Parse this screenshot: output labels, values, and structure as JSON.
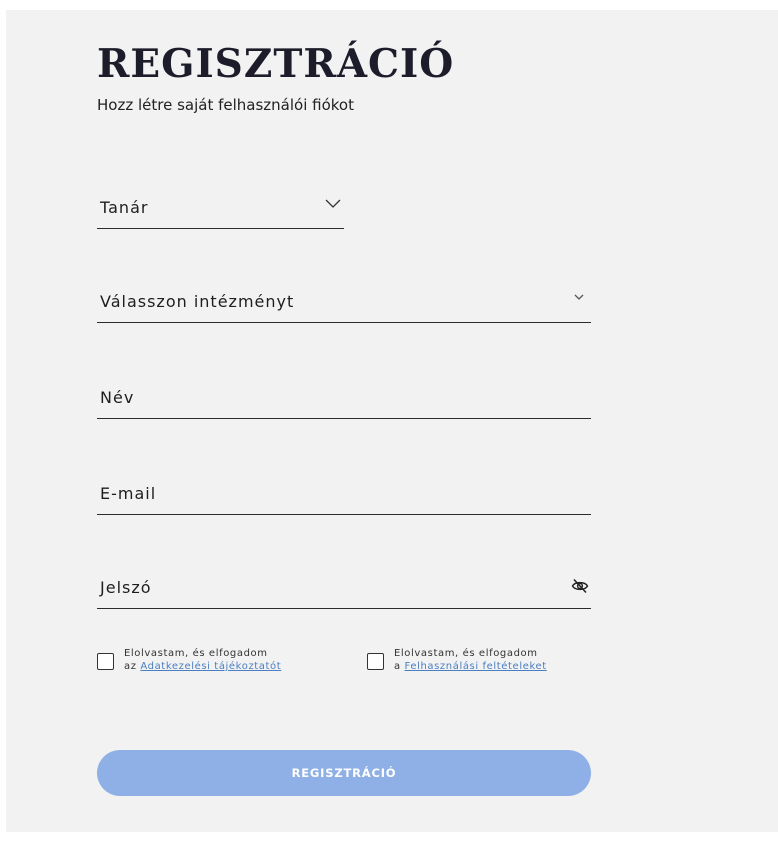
{
  "header": {
    "title": "REGISZTRÁCIÓ",
    "subtitle": "Hozz létre saját felhasználói fiókot"
  },
  "form": {
    "role_select": {
      "value": "Tanár",
      "icon": "chevron-down-icon"
    },
    "institution_select": {
      "placeholder": "Válasszon intézményt",
      "icon": "chevron-down-icon"
    },
    "name_field": {
      "placeholder": "Név"
    },
    "email_field": {
      "placeholder": "E-mail"
    },
    "password_field": {
      "placeholder": "Jelszó",
      "icon": "eye-off-icon"
    },
    "privacy_consent": {
      "line1": "Elolvastam, és elfogadom",
      "prefix": "az",
      "link": "Adatkezelési tájékoztatót",
      "checked": false
    },
    "terms_consent": {
      "line1": "Elolvastam, és elfogadom",
      "prefix": "a",
      "link": "Felhasználási feltételeket",
      "checked": false
    },
    "submit_label": "REGISZTRÁCIÓ"
  },
  "colors": {
    "panel_bg": "#f2f2f2",
    "button_bg": "#8eb0e6",
    "link": "#4a7fc1",
    "text": "#1e1e1e"
  }
}
